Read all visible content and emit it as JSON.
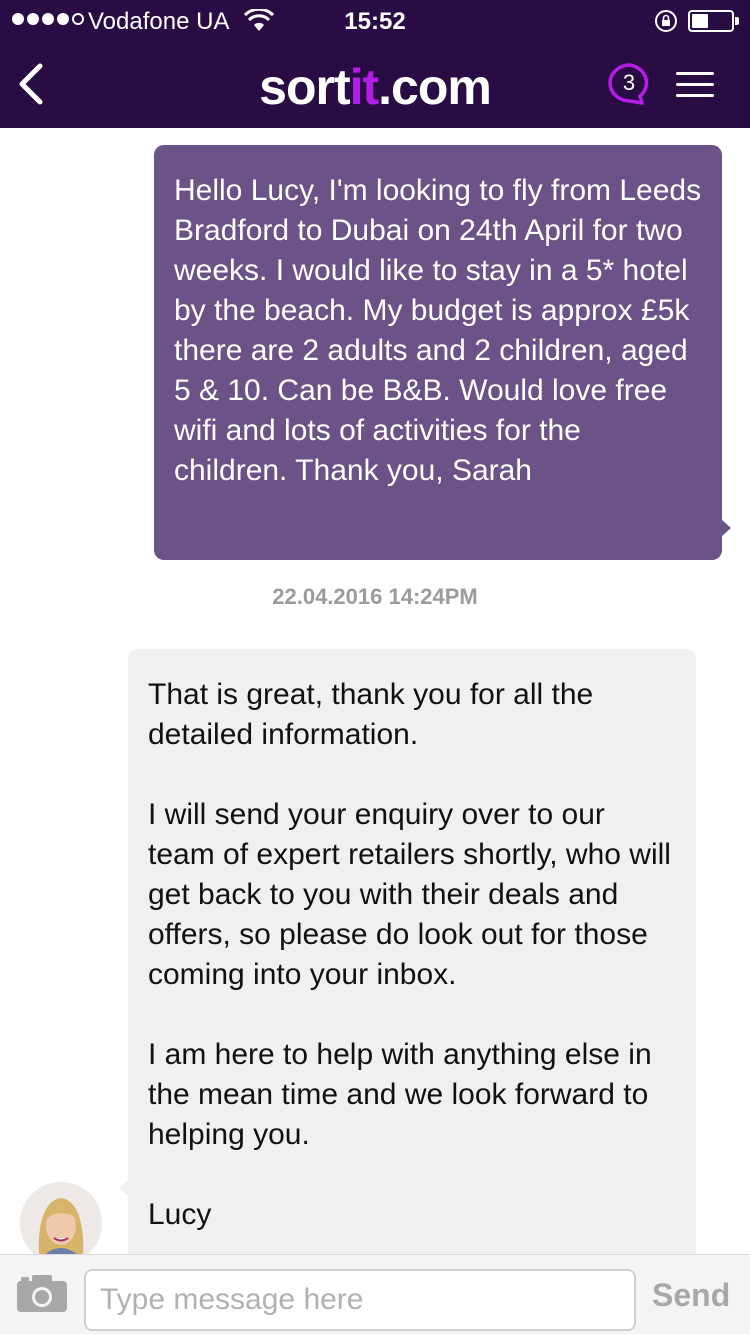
{
  "status_bar": {
    "carrier": "Vodafone UA",
    "time": "15:52",
    "signal_bars_filled": 4,
    "signal_bars_total": 5,
    "icons": [
      "signal-icon",
      "wifi-icon",
      "orientation-lock-icon",
      "battery-icon"
    ]
  },
  "nav": {
    "logo_main": "sort",
    "logo_accent": "it",
    "logo_tail": ".com",
    "notification_count": "3",
    "icons": [
      "back-arrow-icon",
      "chat-bubble-icon",
      "hamburger-menu-icon"
    ],
    "colors": {
      "bar": "#2a0c45",
      "accent": "#b31ee6"
    }
  },
  "messages": {
    "outgoing": {
      "text": "Hello Lucy, I'm looking to fly from Leeds Bradford to Dubai on 24th April for two weeks. I would like to stay in a 5* hotel by the beach. My budget is approx £5k there are 2 adults and 2 children, aged 5 & 10. Can be B&B. Would love free wifi and lots of activities for the children. Thank you, Sarah",
      "bubble_color": "#6b5287"
    },
    "timestamp": "22.04.2016 14:24PM",
    "incoming": {
      "paragraphs": [
        "That is great, thank you for all the detailed information.",
        "I will send your enquiry over to our team of expert retailers shortly, who will get back to you with their deals and offers, so please do look out for those coming into your inbox.",
        "I am here to help with anything else in the mean time and we look forward to helping you.",
        "Lucy"
      ],
      "bubble_color": "#eff0ef"
    }
  },
  "composer": {
    "placeholder": "Type message here",
    "value": "",
    "send_label": "Send",
    "icons": [
      "camera-icon"
    ]
  }
}
